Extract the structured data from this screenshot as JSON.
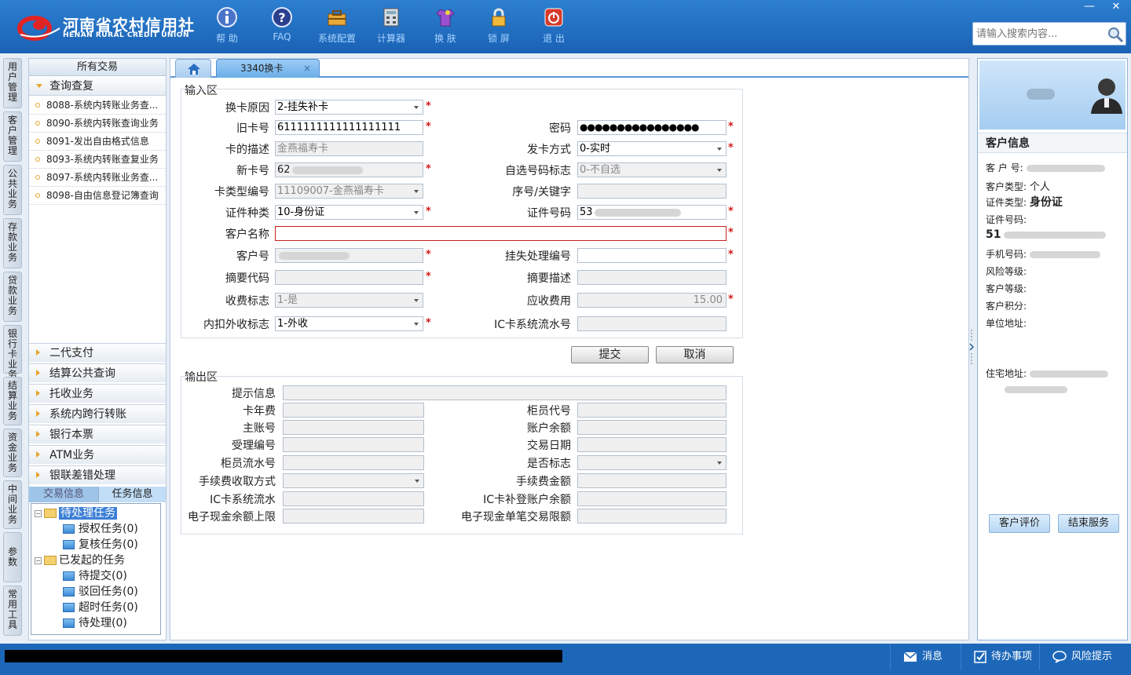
{
  "header": {
    "logo_cn": "河南省农村信用社",
    "logo_en": "HENAN RURAL CREDIT UNION",
    "toolbar": [
      {
        "label": "帮 助",
        "icon": "info-icon"
      },
      {
        "label": "FAQ",
        "icon": "question-icon"
      },
      {
        "label": "系统配置",
        "icon": "toolbox-icon"
      },
      {
        "label": "计算器",
        "icon": "calculator-icon"
      },
      {
        "label": "换 肤",
        "icon": "shirt-icon"
      },
      {
        "label": "锁 屏",
        "icon": "lock-icon"
      },
      {
        "label": "退 出",
        "icon": "power-icon"
      }
    ],
    "search_placeholder": "请输入搜索内容..."
  },
  "vtabs": [
    "用户管理",
    "客户管理",
    "公共业务",
    "存款业务",
    "贷款业务",
    "银行卡业务",
    "结算业务",
    "资金业务",
    "中间业务",
    "参数",
    "常用工具"
  ],
  "left": {
    "all_tx": "所有交易",
    "query_header": "查询查复",
    "query_items": [
      "8088-系统内转账业务查...",
      "8090-系统内转账查询业务",
      "8091-发出自由格式信息",
      "8093-系统内转账查复业务",
      "8097-系统内转账业务查...",
      "8098-自由信息登记簿查询"
    ],
    "categories": [
      "二代支付",
      "结算公共查询",
      "托收业务",
      "系统内跨行转账",
      "银行本票",
      "ATM业务",
      "银联差错处理"
    ],
    "tab_tx": "交易信息",
    "tab_task": "任务信息",
    "tree": {
      "pending": "待处理任务",
      "auth": "授权任务(0)",
      "review": "复核任务(0)",
      "initiated": "已发起的任务",
      "to_submit": "待提交(0)",
      "rejected": "驳回任务(0)",
      "timeout": "超时任务(0)",
      "to_process": "待处理(0)"
    }
  },
  "tabs": {
    "active": "3340换卡",
    "close": "×"
  },
  "input": {
    "title": "输入区",
    "labels": {
      "reason": "换卡原因",
      "old_card": "旧卡号",
      "password": "密码",
      "card_desc": "卡的描述",
      "issue_mode": "发卡方式",
      "new_card": "新卡号",
      "self_select": "自选号码标志",
      "card_type": "卡类型编号",
      "seq": "序号/关键字",
      "id_type": "证件种类",
      "id_no": "证件号码",
      "cust_name": "客户名称",
      "cust_no": "客户号",
      "loss_no": "挂失处理编号",
      "abstract_code": "摘要代码",
      "abstract_desc": "摘要描述",
      "fee_flag": "收费标志",
      "fee_due": "应收费用",
      "inout_flag": "内扣外收标志",
      "ic_flow": "IC卡系统流水号"
    },
    "values": {
      "reason": "2-挂失补卡",
      "old_card": "6111111111111111111",
      "password": "●●●●●●●●●●●●●●●●",
      "card_desc": "金燕福寿卡",
      "issue_mode": "0-实时",
      "new_card": "62",
      "self_select": "0-不自选",
      "card_type": "11109007-金燕福寿卡",
      "id_type": "10-身份证",
      "id_no": "53",
      "fee_flag": "1-是",
      "fee_due": "15.00",
      "inout_flag": "1-外收"
    },
    "submit": "提交",
    "cancel": "取消"
  },
  "output": {
    "title": "输出区",
    "labels": {
      "hint": "提示信息",
      "card_fee": "卡年费",
      "teller": "柜员代号",
      "main_acct": "主账号",
      "balance": "账户余额",
      "accept_no": "受理编号",
      "tx_date": "交易日期",
      "teller_flow": "柜员流水号",
      "yes_no": "是否标志",
      "fee_mode": "手续费收取方式",
      "fee_amt": "手续费金额",
      "ic_flow": "IC卡系统流水",
      "ic_balance": "IC卡补登账户余额",
      "ecash_limit": "电子现金余额上限",
      "ecash_single": "电子现金单笔交易限额"
    }
  },
  "customer": {
    "title": "客户信息",
    "cust_no": "客 户 号:",
    "cust_type_label": "客户类型:",
    "cust_type": "个人",
    "id_type_label": "证件类型:",
    "id_type": "身份证",
    "id_no_label": "证件号码:",
    "id_no_prefix": "51",
    "phone": "手机号码:",
    "risk": "风险等级:",
    "level": "客户等级:",
    "points": "客户积分:",
    "company": "单位地址:",
    "home": "住宅地址:",
    "evaluate": "客户评价",
    "end": "结束服务"
  },
  "status": {
    "msg": "消息",
    "todo": "待办事项",
    "risk": "风险提示"
  },
  "colors": {
    "header": "#1a62b5",
    "accent": "#3c7fd6",
    "required": "#d41818"
  }
}
